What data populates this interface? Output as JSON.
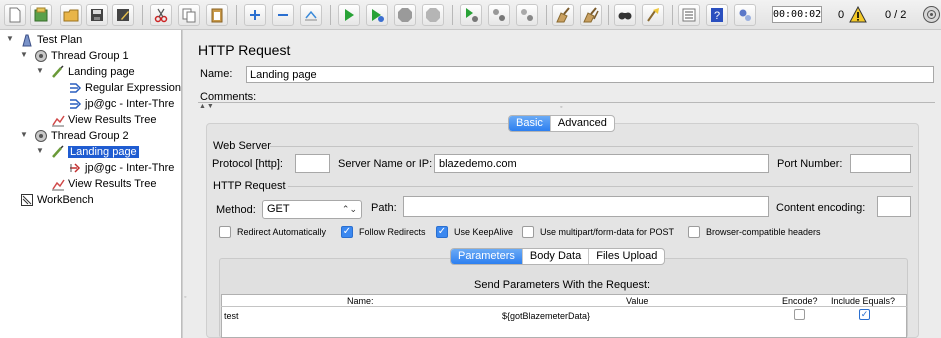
{
  "toolbar": {
    "icons": [
      "new-icon",
      "templates-icon",
      "open-icon",
      "save-icon",
      "save-as-icon",
      "cut-icon",
      "copy-icon",
      "paste-icon",
      "expand-icon",
      "collapse-icon",
      "toggle-icon",
      "start-icon",
      "start-no-pauses-icon",
      "stop-icon",
      "shutdown-icon",
      "remote-start-icon",
      "remote-stop-icon",
      "remote-shutdown-icon",
      "clear-icon",
      "clear-all-icon",
      "search-icon",
      "reset-search-icon",
      "function-helper-icon",
      "help-icon",
      "settings-icon"
    ],
    "timer": "00:00:02",
    "error_count": "0",
    "threads": "0 / 2"
  },
  "tree": {
    "nodes": [
      {
        "label": "Test Plan",
        "icon": "test-plan-icon"
      },
      {
        "label": "Thread Group 1",
        "icon": "thread-group-icon"
      },
      {
        "label": "Landing page",
        "icon": "http-sampler-icon"
      },
      {
        "label": "Regular Expression",
        "icon": "extractor-icon"
      },
      {
        "label": "jp@gc - Inter-Thre",
        "icon": "extractor-icon"
      },
      {
        "label": "View Results Tree",
        "icon": "listener-icon"
      },
      {
        "label": "Thread Group 2",
        "icon": "thread-group-icon"
      },
      {
        "label": "Landing page",
        "icon": "http-sampler-icon"
      },
      {
        "label": "jp@gc - Inter-Thre",
        "icon": "preprocessor-icon"
      },
      {
        "label": "View Results Tree",
        "icon": "listener-icon"
      },
      {
        "label": "WorkBench",
        "icon": "workbench-icon"
      }
    ]
  },
  "panel": {
    "title": "HTTP Request",
    "name_label": "Name:",
    "name_value": "Landing page",
    "comments_label": "Comments:",
    "tabs": [
      "Basic",
      "Advanced"
    ],
    "active_tab": "Basic",
    "web_server": {
      "legend": "Web Server",
      "protocol_label": "Protocol [http]:",
      "protocol_value": "",
      "server_label": "Server Name or IP:",
      "server_value": "blazedemo.com",
      "port_label": "Port Number:",
      "port_value": ""
    },
    "http_request": {
      "legend": "HTTP Request",
      "method_label": "Method:",
      "method_value": "GET",
      "path_label": "Path:",
      "path_value": "",
      "encoding_label": "Content encoding:",
      "encoding_value": "",
      "options": [
        {
          "label": "Redirect Automatically",
          "checked": false
        },
        {
          "label": "Follow Redirects",
          "checked": true
        },
        {
          "label": "Use KeepAlive",
          "checked": true
        },
        {
          "label": "Use multipart/form-data for POST",
          "checked": false
        },
        {
          "label": "Browser-compatible headers",
          "checked": false
        }
      ]
    },
    "sub_tabs": [
      "Parameters",
      "Body Data",
      "Files Upload"
    ],
    "active_sub_tab": "Parameters",
    "params": {
      "title": "Send Parameters With the Request:",
      "columns": [
        "Name:",
        "Value",
        "Encode?",
        "Include Equals?"
      ],
      "rows": [
        {
          "name": "test",
          "value": "${gotBlazemeterData}",
          "encode": false,
          "include_equals": true
        }
      ]
    }
  }
}
